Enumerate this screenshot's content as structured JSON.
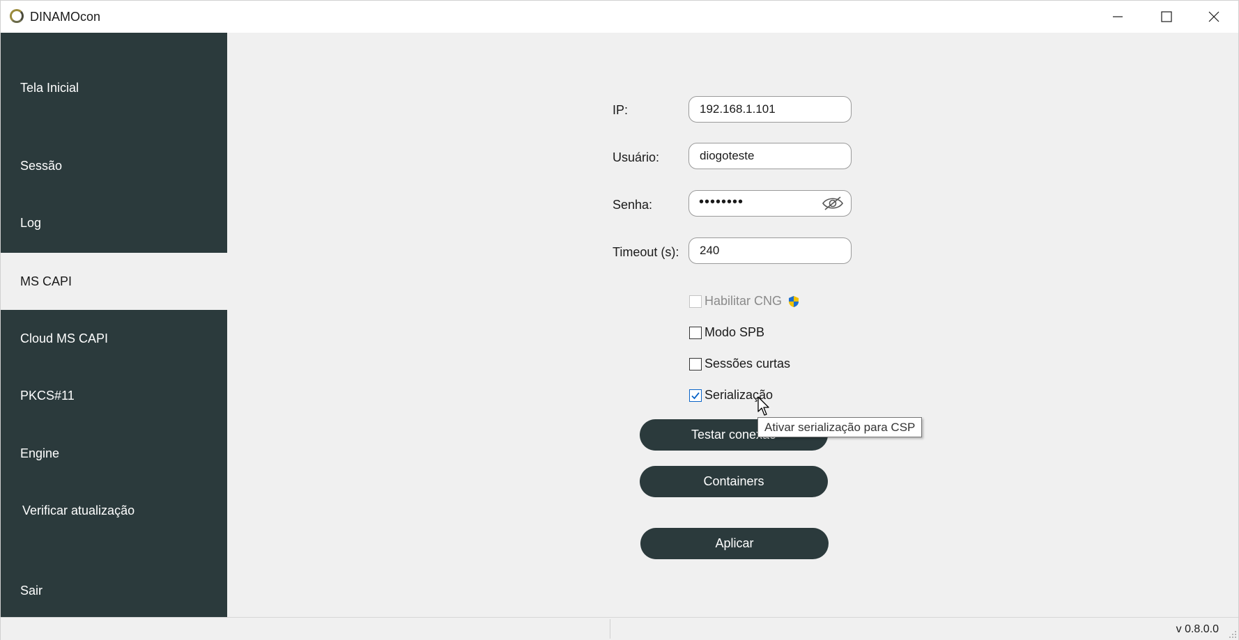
{
  "window": {
    "title": "DINAMOcon",
    "controls": {
      "minimize": "minimize-icon",
      "maximize": "maximize-icon",
      "close": "close-icon"
    }
  },
  "sidebar": {
    "items": [
      {
        "label": "Tela Inicial",
        "active": false
      },
      {
        "label": "Sessão",
        "active": false
      },
      {
        "label": "Log",
        "active": false
      },
      {
        "label": "MS CAPI",
        "active": true
      },
      {
        "label": "Cloud MS CAPI",
        "active": false
      },
      {
        "label": "PKCS#11",
        "active": false
      },
      {
        "label": "Engine",
        "active": false
      },
      {
        "label": "Verificar atualização",
        "active": false
      },
      {
        "label": "Sair",
        "active": false
      }
    ]
  },
  "form": {
    "ip": {
      "label": "IP:",
      "value": "192.168.1.101"
    },
    "user": {
      "label": "Usuário:",
      "value": "diogoteste"
    },
    "password": {
      "label": "Senha:",
      "masked": "••••••••"
    },
    "timeout": {
      "label": "Timeout (s):",
      "value": "240"
    }
  },
  "options": {
    "habilitar_cng": {
      "label": "Habilitar CNG",
      "checked": false,
      "disabled": true
    },
    "modo_spb": {
      "label": "Modo SPB",
      "checked": false
    },
    "sessoes_curtas": {
      "label": "Sessões curtas",
      "checked": false
    },
    "serializacao": {
      "label": "Serialização",
      "checked": true
    }
  },
  "buttons": {
    "test_connection": "Testar conexão",
    "containers": "Containers",
    "apply": "Aplicar"
  },
  "tooltip": {
    "text": "Ativar serialização para CSP"
  },
  "statusbar": {
    "version": "v 0.8.0.0"
  },
  "colors": {
    "sidebar_bg": "#2b3a3c",
    "main_bg": "#f0f0f0",
    "button_bg": "#2b3a3c",
    "checkbox_accent": "#0a64c8"
  }
}
